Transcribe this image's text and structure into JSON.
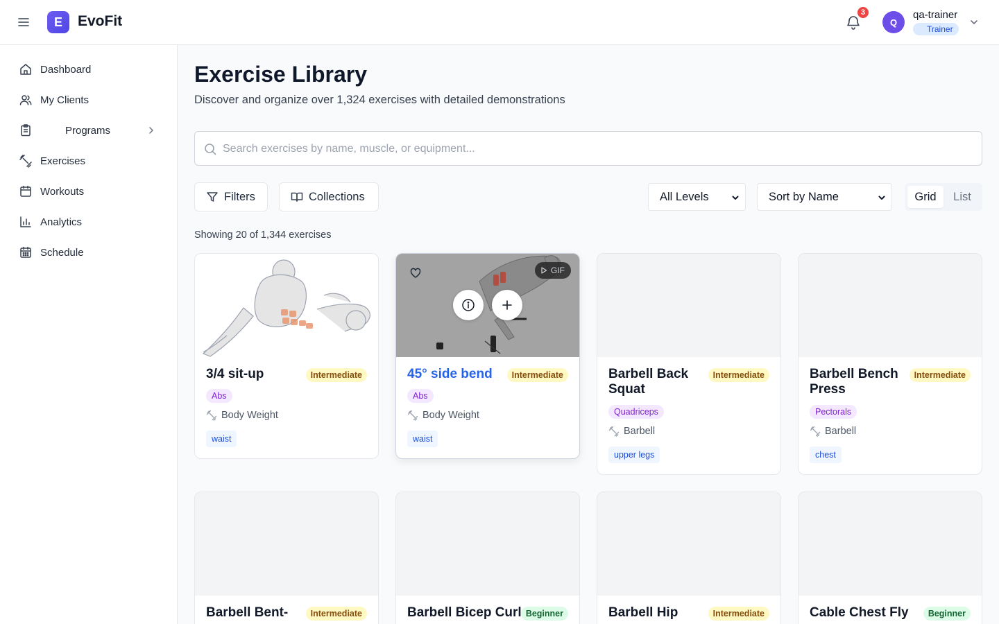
{
  "app": {
    "brand_letter": "E",
    "brand_name": "EvoFit"
  },
  "header": {
    "notification_count": "3",
    "avatar_initial": "Q",
    "user_name": "qa-trainer",
    "user_role": "Trainer"
  },
  "sidebar": {
    "items": [
      {
        "label": "Dashboard",
        "icon": "home-icon"
      },
      {
        "label": "My Clients",
        "icon": "users-icon"
      },
      {
        "label": "Programs",
        "icon": "clipboard-icon"
      },
      {
        "label": "Exercises",
        "icon": "dumbbell-icon"
      },
      {
        "label": "Workouts",
        "icon": "calendar-icon"
      },
      {
        "label": "Analytics",
        "icon": "bar-chart-icon"
      },
      {
        "label": "Schedule",
        "icon": "calendar-grid-icon"
      }
    ]
  },
  "page": {
    "title": "Exercise Library",
    "subtitle": "Discover and organize over 1,324 exercises with detailed demonstrations",
    "search_placeholder": "Search exercises by name, muscle, or equipment...",
    "search_value": "",
    "filters_label": "Filters",
    "collections_label": "Collections",
    "level_select": "All Levels",
    "sort_select": "Sort by Name",
    "view_grid": "Grid",
    "view_list": "List",
    "count_text": "Showing 20 of 1,344 exercises",
    "gif_label": "GIF"
  },
  "exercises": [
    {
      "name": "3/4 sit-up",
      "level": "Intermediate",
      "muscle": "Abs",
      "equipment": "Body Weight",
      "body_part": "waist"
    },
    {
      "name": "45° side bend",
      "level": "Intermediate",
      "muscle": "Abs",
      "equipment": "Body Weight",
      "body_part": "waist"
    },
    {
      "name": "Barbell Back Squat",
      "level": "Intermediate",
      "muscle": "Quadriceps",
      "equipment": "Barbell",
      "body_part": "upper legs"
    },
    {
      "name": "Barbell Bench Press",
      "level": "Intermediate",
      "muscle": "Pectorals",
      "equipment": "Barbell",
      "body_part": "chest"
    },
    {
      "name": "Barbell Bent-",
      "level": "Intermediate"
    },
    {
      "name": "Barbell Bicep Curl",
      "level": "Beginner"
    },
    {
      "name": "Barbell Hip",
      "level": "Intermediate"
    },
    {
      "name": "Cable Chest Fly",
      "level": "Beginner"
    }
  ],
  "colors": {
    "primary": "#2563eb",
    "brand": "#5b4cf0",
    "intermediate_badge": "#fef9c3",
    "beginner_badge": "#dcfce7",
    "muscle_badge": "#f3e8ff",
    "notification": "#ef4444"
  }
}
